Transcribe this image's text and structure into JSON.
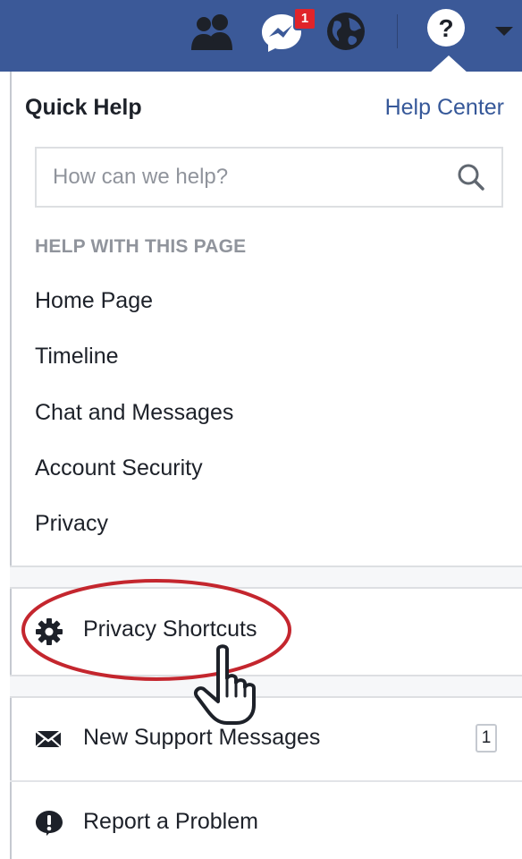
{
  "topbar": {
    "icons": [
      "friends-icon",
      "messenger-icon",
      "globe-icon",
      "help-icon",
      "caret-down-icon"
    ],
    "notification_count": "1",
    "bg_color": "#3b5998"
  },
  "quick_help": {
    "title": "Quick Help",
    "help_center_link": "Help Center",
    "search_placeholder": "How can we help?",
    "section_heading": "HELP WITH THIS PAGE",
    "items": [
      {
        "label": "Home Page"
      },
      {
        "label": "Timeline"
      },
      {
        "label": "Chat and Messages"
      },
      {
        "label": "Account Security"
      },
      {
        "label": "Privacy"
      }
    ],
    "privacy_shortcuts": {
      "label": "Privacy Shortcuts",
      "icon": "gear-icon"
    },
    "support_messages": {
      "label": "New Support Messages",
      "icon": "envelope-icon",
      "count": "1"
    },
    "report_problem": {
      "label": "Report a Problem",
      "icon": "alert-icon"
    }
  },
  "annotation": {
    "highlight_color": "#c4262e",
    "cursor": "hand-cursor"
  }
}
